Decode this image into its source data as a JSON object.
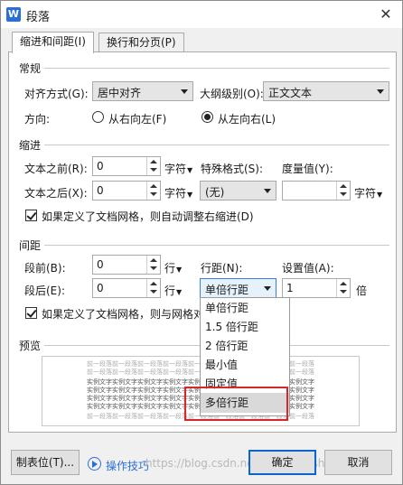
{
  "window": {
    "title": "段落",
    "app_icon": "W"
  },
  "tabs": [
    {
      "label": "缩进和间距(I)",
      "active": true
    },
    {
      "label": "换行和分页(P)",
      "active": false
    }
  ],
  "general": {
    "heading": "常规",
    "align_label": "对齐方式(G):",
    "align_value": "居中对齐",
    "outline_label": "大纲级别(O):",
    "outline_value": "正文文本",
    "direction_label": "方向:",
    "rtl_label": "从右向左(F)",
    "ltr_label": "从左向右(L)",
    "direction_selected": "ltr"
  },
  "indent": {
    "heading": "缩进",
    "before_label": "文本之前(R):",
    "before_value": "0",
    "before_unit": "字符",
    "after_label": "文本之后(X):",
    "after_value": "0",
    "after_unit": "字符",
    "special_label": "特殊格式(S):",
    "special_value": "(无)",
    "measure_label": "度量值(Y):",
    "measure_value": "",
    "measure_unit": "字符",
    "grid_check_label": "如果定义了文档网格，则自动调整右缩进(D)",
    "grid_checked": true
  },
  "spacing": {
    "heading": "间距",
    "before_label": "段前(B):",
    "before_value": "0",
    "before_unit": "行",
    "after_label": "段后(E):",
    "after_value": "0",
    "after_unit": "行",
    "line_label": "行距(N):",
    "line_value": "单倍行距",
    "setting_label": "设置值(A):",
    "setting_value": "1",
    "setting_unit": "倍",
    "grid_check_label": "如果定义了文档网格，则与网格对",
    "grid_checked": true
  },
  "line_spacing_options": [
    "单倍行距",
    "1.5 倍行距",
    "2 倍行距",
    "最小值",
    "固定值",
    "多倍行距"
  ],
  "line_spacing_highlighted": "多倍行距",
  "preview": {
    "heading": "预览",
    "prev_text": "前一段落前一段落前一段落前一段落前一段落前一段落前一段落前一段落前一段落",
    "sample_text": "实例文字实例文字实例文字实例文字实例文字实例文字实例文字实例文字实例文字"
  },
  "footer": {
    "tabstops_label": "制表位(T)...",
    "tips_label": "操作技巧",
    "ok_label": "确定",
    "cancel_label": "取消"
  },
  "watermark": "https://blog.csdn.net/lingmengshuxiawo"
}
